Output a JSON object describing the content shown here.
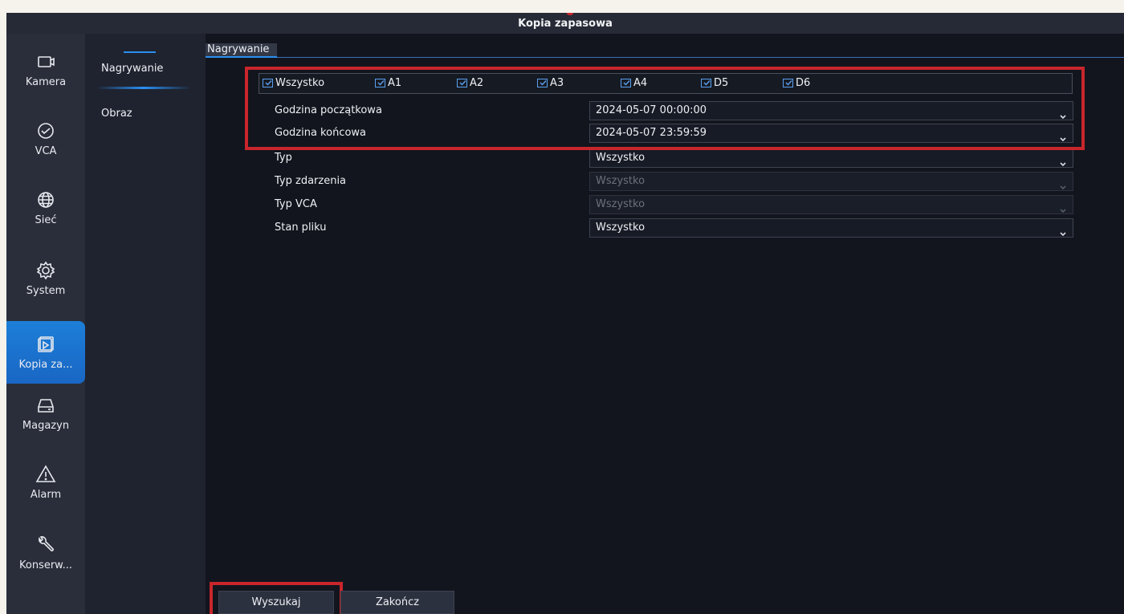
{
  "window": {
    "title": "Kopia zapasowa"
  },
  "sidebar": {
    "items": [
      {
        "label": "Kamera",
        "icon": "camera-icon"
      },
      {
        "label": "VCA",
        "icon": "vca-icon"
      },
      {
        "label": "Sieć",
        "icon": "globe-icon"
      },
      {
        "label": "System",
        "icon": "gear-icon"
      },
      {
        "label": "Kopia za...",
        "icon": "backup-icon",
        "active": true
      },
      {
        "label": "Magazyn",
        "icon": "storage-icon"
      },
      {
        "label": "Alarm",
        "icon": "alarm-icon"
      },
      {
        "label": "Konserw...",
        "icon": "wrench-icon"
      }
    ]
  },
  "subnav": {
    "items": [
      {
        "label": "Nagrywanie",
        "active": true
      },
      {
        "label": "Obraz"
      }
    ]
  },
  "tabs": [
    {
      "label": "Nagrywanie",
      "active": true
    }
  ],
  "channels": [
    {
      "label": "Wszystko",
      "checked": true
    },
    {
      "label": "A1",
      "checked": true
    },
    {
      "label": "A2",
      "checked": true
    },
    {
      "label": "A3",
      "checked": true
    },
    {
      "label": "A4",
      "checked": true
    },
    {
      "label": "D5",
      "checked": true
    },
    {
      "label": "D6",
      "checked": true
    }
  ],
  "form": {
    "start_time": {
      "label": "Godzina początkowa",
      "value": "2024-05-07 00:00:00"
    },
    "end_time": {
      "label": "Godzina końcowa",
      "value": "2024-05-07 23:59:59"
    },
    "type": {
      "label": "Typ",
      "value": "Wszystko"
    },
    "event_type": {
      "label": "Typ zdarzenia",
      "value": "Wszystko",
      "disabled": true
    },
    "vca_type": {
      "label": "Typ VCA",
      "value": "Wszystko",
      "disabled": true
    },
    "file_state": {
      "label": "Stan pliku",
      "value": "Wszystko"
    }
  },
  "buttons": {
    "search": "Wyszukaj",
    "close": "Zakończ"
  },
  "colors": {
    "accent": "#1c7fd8",
    "highlight": "#c8262c",
    "background": "#12151d"
  }
}
